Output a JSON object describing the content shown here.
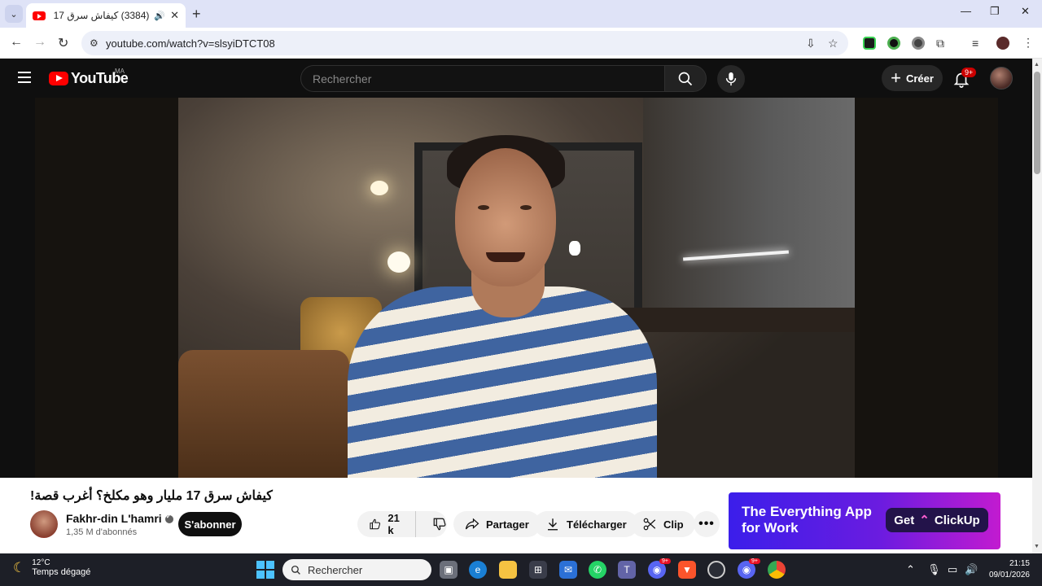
{
  "browser": {
    "tab_title": "(3384) كيفاش سرق 17 مليار",
    "url": "youtube.com/watch?v=slsyiDTCT08",
    "new_tab_glyph": "+",
    "close_glyph": "✕"
  },
  "youtube": {
    "logo_text": "YouTube",
    "country_code": "MA",
    "search_placeholder": "Rechercher",
    "create_label": "Créer",
    "notifications_badge": "9+"
  },
  "video": {
    "title": "كيفاش سرق 17 مليار وهو مكلخ؟ أغرب قصة!",
    "channel_name": "Fakhr-din L'hamri",
    "subscribers": "1,35 M d'abonnés",
    "subscribe_label": "S'abonner",
    "like_count": "21 k",
    "share_label": "Partager",
    "download_label": "Télécharger",
    "clip_label": "Clip",
    "more_label": "•••"
  },
  "ad": {
    "line1": "The Everything App",
    "line2": "for Work",
    "cta_prefix": "Get",
    "cta_brand": "ClickUp"
  },
  "taskbar": {
    "temperature": "12°C",
    "weather": "Temps dégagé",
    "search_placeholder": "Rechercher",
    "time": "21:15",
    "date": "09/01/2026",
    "discord_badge": "9+",
    "discord2_badge": "9+"
  },
  "colors": {
    "youtube_red": "#ff0000",
    "youtube_bg": "#0f0f0f",
    "ad_gradient_start": "#3b1eea",
    "ad_gradient_end": "#c21bd0"
  }
}
